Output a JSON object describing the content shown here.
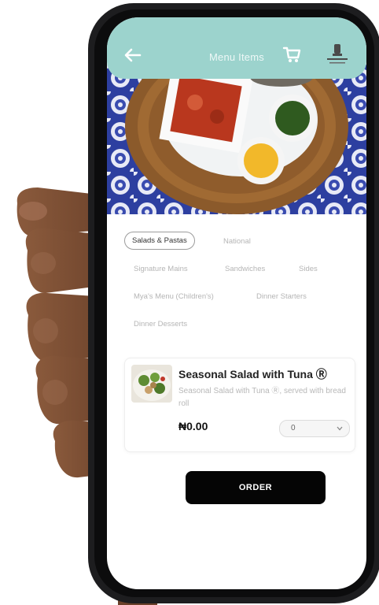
{
  "header": {
    "title": "Menu Items",
    "back_icon": "arrow-left-icon",
    "cart_icon": "cart-icon",
    "logo": "restaurant-logo"
  },
  "hero": {
    "description": "hero-food-image"
  },
  "categories": [
    {
      "label": "Salads & Pastas",
      "active": true
    },
    {
      "label": "National",
      "active": false
    },
    {
      "label": "Signature Mains",
      "active": false
    },
    {
      "label": "Sandwiches",
      "active": false
    },
    {
      "label": "Sides",
      "active": false
    },
    {
      "label": "Mya's Menu (Children's)",
      "active": false
    },
    {
      "label": "Dinner Starters",
      "active": false
    },
    {
      "label": "Dinner Desserts",
      "active": false
    }
  ],
  "item": {
    "name": "Seasonal Salad with Tuna Ⓡ",
    "description": "Seasonal Salad with Tuna Ⓡ, served with bread roll",
    "price": "₦0.00",
    "quantity": "0"
  },
  "order_label": "ORDER",
  "colors": {
    "header_bg": "#9cd3cd",
    "order_bg": "#050505",
    "phone_frame": "#1d1d1f"
  }
}
